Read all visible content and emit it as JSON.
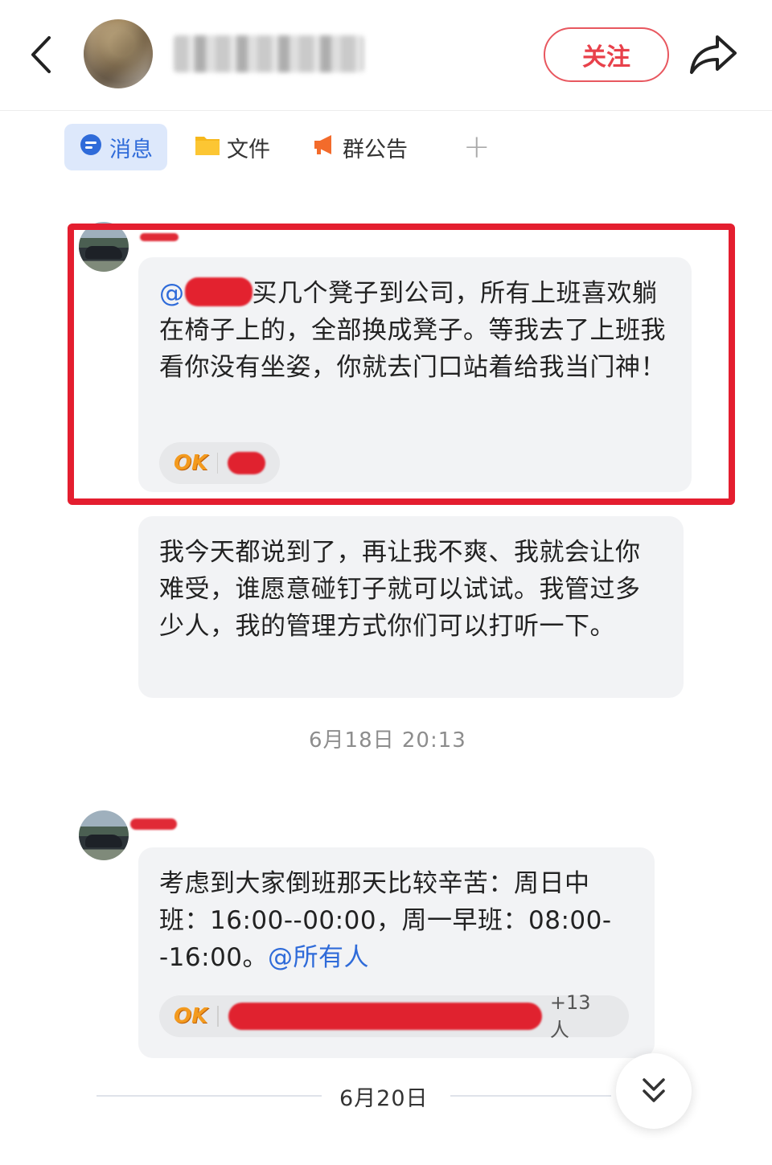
{
  "header": {
    "follow_label": "关注"
  },
  "tabs": [
    {
      "label": "消息",
      "active": true
    },
    {
      "label": "文件"
    },
    {
      "label": "群公告"
    },
    {
      "label": "+"
    }
  ],
  "messages": [
    {
      "mention_prefix": "@",
      "text": "买几个凳子到公司，所有上班喜欢躺在椅子上的，全部换成凳子。等我去了上班我看你没有坐姿，你就去门口站着给我当门神！",
      "reaction": "OK"
    },
    {
      "text": "我今天都说到了，再让我不爽、我就会让你难受，谁愿意碰钉子就可以试试。我管过多少人，我的管理方式你们可以打听一下。"
    },
    {
      "text_before": "考虑到大家倒班那天比较辛苦：周日中班：16:00--00:00，周一早班：08:00--16:00。",
      "mention": "@所有人",
      "reaction": "OK",
      "reaction_count": "+13 人"
    }
  ],
  "timestamps": {
    "first": "6月18日 20:13",
    "divider": "6月20日"
  },
  "colors": {
    "accent_blue": "#2f6bd9",
    "follow_red": "#e8414b",
    "highlight_red": "#e41e2f"
  },
  "icons": {
    "back": "chevron-left-icon",
    "share": "share-arrow-icon",
    "scroll_down": "double-chevron-down-icon"
  }
}
